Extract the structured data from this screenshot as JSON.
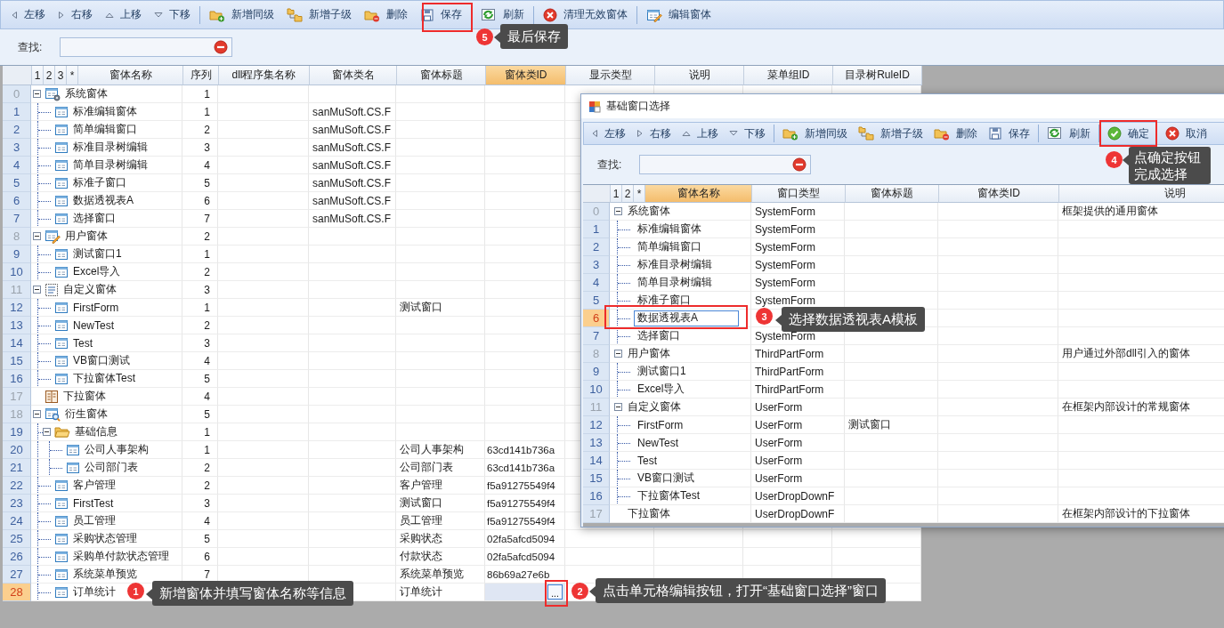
{
  "main": {
    "toolbar": [
      {
        "kind": "left",
        "label": "左移"
      },
      {
        "kind": "right",
        "label": "右移"
      },
      {
        "kind": "up",
        "label": "上移"
      },
      {
        "kind": "down",
        "label": "下移"
      },
      {
        "kind": "separator"
      },
      {
        "kind": "add_sibling",
        "label": "新增同级"
      },
      {
        "kind": "add_child",
        "label": "新增子级"
      },
      {
        "kind": "delete",
        "label": "删除"
      },
      {
        "kind": "save",
        "label": "保存"
      },
      {
        "kind": "separator"
      },
      {
        "kind": "refresh",
        "label": "刷新"
      },
      {
        "kind": "separator"
      },
      {
        "kind": "clear",
        "label": "清理无效窗体"
      },
      {
        "kind": "separator"
      },
      {
        "kind": "edit",
        "label": "编辑窗体"
      }
    ],
    "search": {
      "label": "查找:"
    },
    "grid": {
      "level_buttons": [
        "1",
        "2",
        "3",
        "*"
      ],
      "columns": [
        {
          "label": "窗体名称",
          "selected": false
        },
        {
          "label": "序列",
          "selected": false
        },
        {
          "label": "dll程序集名称",
          "selected": false
        },
        {
          "label": "窗体类名",
          "selected": false
        },
        {
          "label": "窗体标题",
          "selected": false
        },
        {
          "label": "窗体类ID",
          "selected": true
        },
        {
          "label": "显示类型",
          "selected": false
        },
        {
          "label": "说明",
          "selected": false
        },
        {
          "label": "菜单组ID",
          "selected": false
        },
        {
          "label": "目录树RuleID",
          "selected": false
        }
      ],
      "rows": [
        {
          "num": "0",
          "kind": "system",
          "name": "系统窗体",
          "seq": "1",
          "selected": false,
          "expanded": true,
          "children": [
            {
              "num": "1",
              "kind": "form",
              "name": "标准编辑窗体",
              "seq": "1",
              "class_name": "sanMuSoft.CS.F",
              "selected": false
            },
            {
              "num": "2",
              "kind": "form",
              "name": "简单编辑窗口",
              "seq": "2",
              "class_name": "sanMuSoft.CS.F",
              "selected": false
            },
            {
              "num": "3",
              "kind": "form",
              "name": "标准目录树编辑",
              "seq": "3",
              "class_name": "sanMuSoft.CS.F",
              "selected": false
            },
            {
              "num": "4",
              "kind": "form",
              "name": "简单目录树编辑",
              "seq": "4",
              "class_name": "sanMuSoft.CS.F",
              "selected": false
            },
            {
              "num": "5",
              "kind": "form",
              "name": "标准子窗口",
              "seq": "5",
              "class_name": "sanMuSoft.CS.F",
              "selected": false
            },
            {
              "num": "6",
              "kind": "form",
              "name": "数据透视表A",
              "seq": "6",
              "class_name": "sanMuSoft.CS.F",
              "selected": false
            },
            {
              "num": "7",
              "kind": "form",
              "name": "选择窗口",
              "seq": "7",
              "class_name": "sanMuSoft.CS.F",
              "selected": false
            }
          ]
        },
        {
          "num": "8",
          "kind": "user",
          "name": "用户窗体",
          "seq": "2",
          "selected": false,
          "expanded": true,
          "children": [
            {
              "num": "9",
              "kind": "form",
              "name": "测试窗口1",
              "seq": "1",
              "selected": false
            },
            {
              "num": "10",
              "kind": "form",
              "name": "Excel导入",
              "seq": "2",
              "selected": false
            }
          ]
        },
        {
          "num": "11",
          "kind": "custom",
          "name": "自定义窗体",
          "seq": "3",
          "selected": false,
          "expanded": true,
          "children": [
            {
              "num": "12",
              "kind": "form",
              "name": "FirstForm",
              "seq": "1",
              "title": "测试窗口",
              "selected": false
            },
            {
              "num": "13",
              "kind": "form",
              "name": "NewTest",
              "seq": "2",
              "selected": false
            },
            {
              "num": "14",
              "kind": "form",
              "name": "Test",
              "seq": "3",
              "selected": false
            },
            {
              "num": "15",
              "kind": "form",
              "name": "VB窗口测试",
              "seq": "4",
              "selected": false
            },
            {
              "num": "16",
              "kind": "form",
              "name": "下拉窗体Test",
              "seq": "5",
              "selected": false
            }
          ]
        },
        {
          "num": "17",
          "kind": "dropdown",
          "name": "下拉窗体",
          "seq": "4",
          "selected": false
        },
        {
          "num": "18",
          "kind": "derived",
          "name": "衍生窗体",
          "seq": "5",
          "selected": false,
          "expanded": true,
          "children": [
            {
              "num": "19",
              "kind": "folder",
              "name": "基础信息",
              "seq": "1",
              "selected": false,
              "expanded": true,
              "children": [
                {
                  "num": "20",
                  "kind": "form",
                  "name": "公司人事架构",
                  "seq": "1",
                  "title": "公司人事架构",
                  "class_id": "63cd141b736a",
                  "selected": false
                },
                {
                  "num": "21",
                  "kind": "form",
                  "name": "公司部门表",
                  "seq": "2",
                  "title": "公司部门表",
                  "class_id": "63cd141b736a",
                  "selected": false
                }
              ]
            },
            {
              "num": "22",
              "kind": "form",
              "name": "客户管理",
              "seq": "2",
              "title": "客户管理",
              "class_id": "f5a91275549f4",
              "selected": false
            },
            {
              "num": "23",
              "kind": "form",
              "name": "FirstTest",
              "seq": "3",
              "title": "测试窗口",
              "class_id": "f5a91275549f4",
              "selected": false
            },
            {
              "num": "24",
              "kind": "form",
              "name": "员工管理",
              "seq": "4",
              "title": "员工管理",
              "class_id": "f5a91275549f4",
              "selected": false
            },
            {
              "num": "25",
              "kind": "form",
              "name": "采购状态管理",
              "seq": "5",
              "title": "采购状态",
              "class_id": "02fa5afcd5094",
              "selected": false
            },
            {
              "num": "26",
              "kind": "form",
              "name": "采购单付款状态管理",
              "seq": "6",
              "title": "付款状态",
              "class_id": "02fa5afcd5094",
              "selected": false
            },
            {
              "num": "27",
              "kind": "form",
              "name": "系统菜单预览",
              "seq": "7",
              "title": "系统菜单预览",
              "class_id": "86b69a27e6b",
              "selected": false
            },
            {
              "num": "28",
              "kind": "form",
              "name": "订单统计",
              "title": "订单统计",
              "edit_button": "...",
              "selected": true
            }
          ]
        }
      ]
    }
  },
  "dialog": {
    "title": "基础窗口选择",
    "toolbar": [
      {
        "kind": "left",
        "label": "左移"
      },
      {
        "kind": "right",
        "label": "右移"
      },
      {
        "kind": "up",
        "label": "上移"
      },
      {
        "kind": "down",
        "label": "下移"
      },
      {
        "kind": "separator"
      },
      {
        "kind": "add_sibling",
        "label": "新增同级"
      },
      {
        "kind": "add_child",
        "label": "新增子级"
      },
      {
        "kind": "delete",
        "label": "删除"
      },
      {
        "kind": "save",
        "label": "保存"
      },
      {
        "kind": "separator"
      },
      {
        "kind": "refresh",
        "label": "刷新"
      },
      {
        "kind": "separator"
      },
      {
        "kind": "ok",
        "label": "确定"
      },
      {
        "kind": "cancel",
        "label": "取消"
      }
    ],
    "search": {
      "label": "查找:"
    },
    "grid": {
      "level_buttons": [
        "1",
        "2",
        "*"
      ],
      "columns": [
        {
          "label": "窗体名称",
          "selected": true
        },
        {
          "label": "窗口类型",
          "selected": false
        },
        {
          "label": "窗体标题",
          "selected": false
        },
        {
          "label": "窗体类ID",
          "selected": false
        },
        {
          "label": "说明",
          "selected": false
        }
      ],
      "rows": [
        {
          "num": "0",
          "name": "系统窗体",
          "form_type": "SystemForm",
          "description": "框架提供的通用窗体",
          "selected": false,
          "expanded": true,
          "children": [
            {
              "num": "1",
              "name": "标准编辑窗体",
              "form_type": "SystemForm",
              "selected": false
            },
            {
              "num": "2",
              "name": "简单编辑窗口",
              "form_type": "SystemForm",
              "selected": false
            },
            {
              "num": "3",
              "name": "标准目录树编辑",
              "form_type": "SystemForm",
              "selected": false
            },
            {
              "num": "4",
              "name": "简单目录树编辑",
              "form_type": "SystemForm",
              "selected": false
            },
            {
              "num": "5",
              "name": "标准子窗口",
              "form_type": "SystemForm",
              "selected": false
            },
            {
              "num": "6",
              "name": "数据透视表A",
              "selected": true
            },
            {
              "num": "7",
              "name": "选择窗口",
              "form_type": "SystemForm",
              "selected": false
            }
          ]
        },
        {
          "num": "8",
          "name": "用户窗体",
          "form_type": "ThirdPartForm",
          "description": "用户通过外部dll引入的窗体",
          "selected": false,
          "expanded": true,
          "children": [
            {
              "num": "9",
              "name": "测试窗口1",
              "form_type": "ThirdPartForm",
              "selected": false
            },
            {
              "num": "10",
              "name": "Excel导入",
              "form_type": "ThirdPartForm",
              "selected": false
            }
          ]
        },
        {
          "num": "11",
          "name": "自定义窗体",
          "form_type": "UserForm",
          "description": "在框架内部设计的常规窗体",
          "selected": false,
          "expanded": true,
          "children": [
            {
              "num": "12",
              "name": "FirstForm",
              "form_type": "UserForm",
              "title": "测试窗口",
              "selected": false
            },
            {
              "num": "13",
              "name": "NewTest",
              "form_type": "UserForm",
              "selected": false
            },
            {
              "num": "14",
              "name": "Test",
              "form_type": "UserForm",
              "selected": false
            },
            {
              "num": "15",
              "name": "VB窗口测试",
              "form_type": "UserForm",
              "selected": false
            },
            {
              "num": "16",
              "name": "下拉窗体Test",
              "form_type": "UserDropDownF",
              "selected": false
            }
          ]
        },
        {
          "num": "17",
          "name": "下拉窗体",
          "form_type": "UserDropDownF",
          "description": "在框架内部设计的下拉窗体",
          "selected": false
        }
      ]
    }
  },
  "callouts": [
    {
      "num": "1",
      "text": "新增窗体并填写窗体名称等信息",
      "framed": false
    },
    {
      "num": "2",
      "text": "点击单元格编辑按钮，打开“基础窗口选择”窗口",
      "framed": true
    },
    {
      "num": "3",
      "text": "选择数据透视表A模板",
      "framed": true
    },
    {
      "num": "4",
      "text": "点确定按钮完成选择",
      "framed": true
    },
    {
      "num": "5",
      "text": "最后保存",
      "framed": true
    }
  ]
}
